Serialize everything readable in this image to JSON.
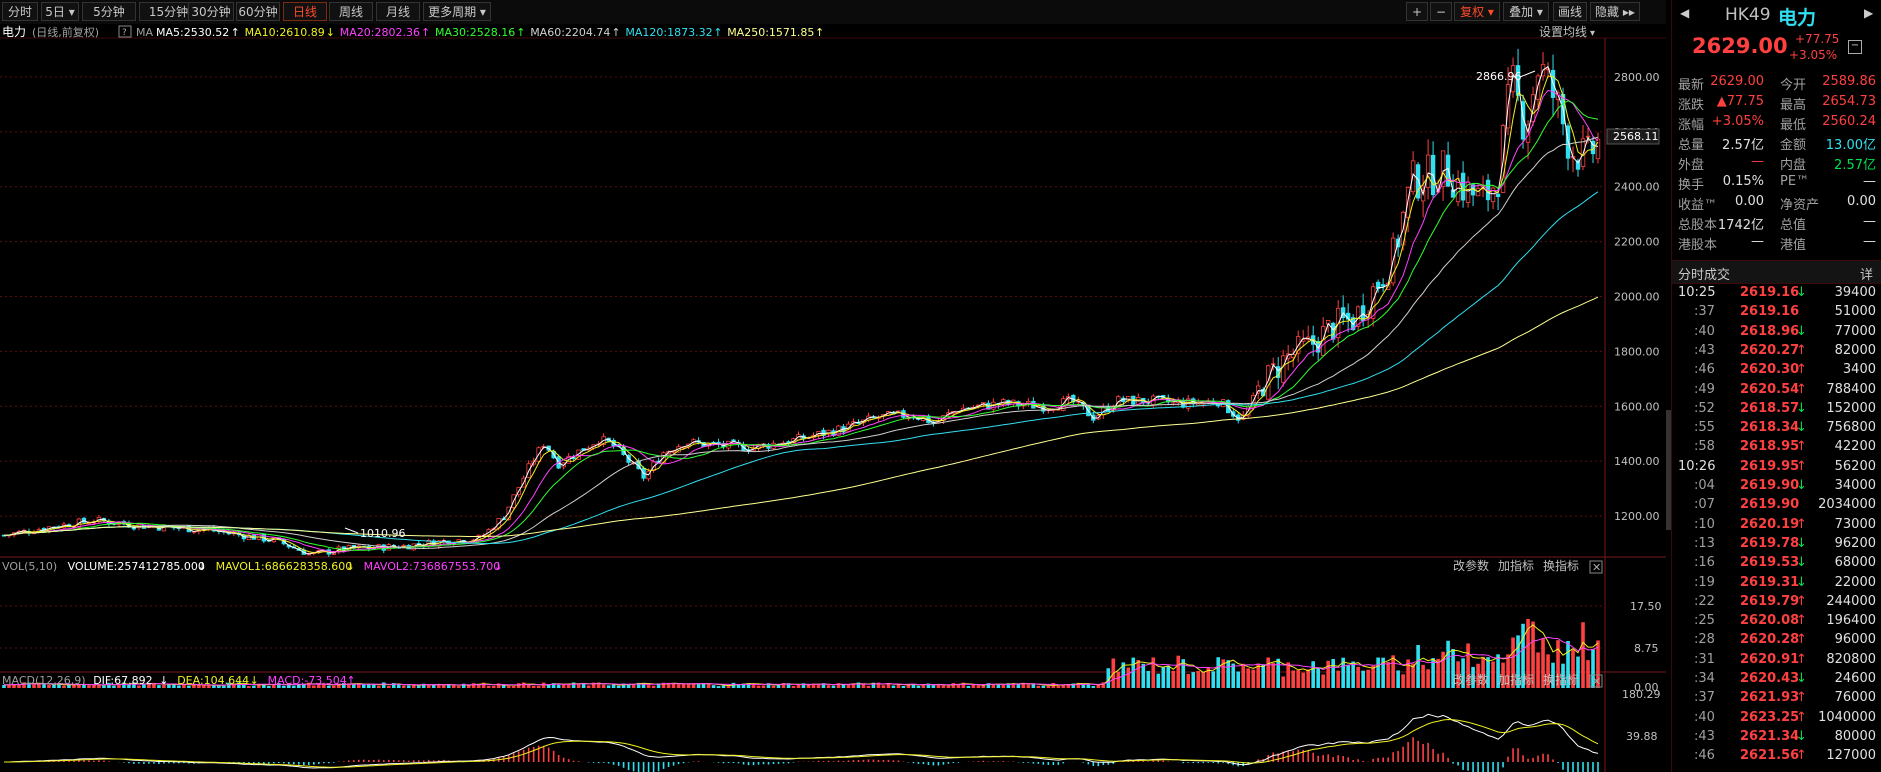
{
  "toolbar": {
    "periods": [
      "分时",
      "5日",
      "5分钟",
      "15分钟",
      "30分钟",
      "60分钟",
      "日线",
      "周线",
      "月线",
      "更多周期"
    ],
    "active_index": 6,
    "right_buttons": [
      "+",
      "−",
      "复权",
      "叠加",
      "画线",
      "隐藏"
    ]
  },
  "chart_header": {
    "name": "电力",
    "mode": "(日线,前复权)",
    "ma_prefix": "MA",
    "ma": [
      {
        "label": "MA5:2530.52",
        "color": "#ffffff",
        "arrow": "↑"
      },
      {
        "label": "MA10:2610.89",
        "color": "#f0f020",
        "arrow": "↓"
      },
      {
        "label": "MA20:2802.36",
        "color": "#ff40ff",
        "arrow": "↑"
      },
      {
        "label": "MA30:2528.16",
        "color": "#30ff30",
        "arrow": "↑"
      },
      {
        "label": "MA60:2204.74",
        "color": "#d0d0d0",
        "arrow": "↑"
      },
      {
        "label": "MA120:1873.32",
        "color": "#30e0f0",
        "arrow": "↑"
      },
      {
        "label": "MA250:1571.85",
        "color": "#ffff90",
        "arrow": "↑"
      }
    ],
    "settings": "设置均线"
  },
  "price_axis": {
    "ticks": [
      "2800.00",
      "2600.00",
      "2400.00",
      "2200.00",
      "2000.00",
      "1800.00",
      "1600.00",
      "1400.00",
      "1200.00"
    ],
    "current": "2568.11",
    "min": 1080,
    "max": 2920
  },
  "annotations": {
    "high": "2866.96",
    "low": "1010.96"
  },
  "volume_panel": {
    "labels": [
      {
        "text": "VOL(5,10)",
        "color": "#a0a0a0"
      },
      {
        "text": "VOLUME:257412785.000",
        "color": "#ffffff",
        "arrow": "↓"
      },
      {
        "text": "MAVOL1:686628358.600",
        "color": "#f0f020",
        "arrow": "↓"
      },
      {
        "text": "MAVOL2:736867553.700",
        "color": "#ff40ff",
        "arrow": "↓"
      }
    ],
    "ticks": [
      "17.50",
      "8.75",
      "0.00"
    ],
    "actions": [
      "改参数",
      "加指标",
      "换指标"
    ]
  },
  "macd_panel": {
    "labels": [
      {
        "text": "MACD(12,26,9)",
        "color": "#a0a0a0"
      },
      {
        "text": "DIF:67.892",
        "color": "#ffffff",
        "arrow": "↓"
      },
      {
        "text": "DEA:104.644",
        "color": "#f0f020",
        "arrow": "↓"
      },
      {
        "text": "MACD:-73.504",
        "color": "#ff40ff",
        "arrow": "↑"
      }
    ],
    "ticks": [
      "180.29",
      "39.88"
    ],
    "actions": [
      "改参数",
      "加指标",
      "换指标"
    ]
  },
  "quote": {
    "code": "HK49",
    "name": "电力",
    "price": "2629.00",
    "change": "+77.75",
    "change_pct": "+3.05%",
    "fields": [
      [
        "最新",
        "2629.00",
        "up",
        "今开",
        "2589.86",
        "up"
      ],
      [
        "涨跌",
        "▲77.75",
        "up",
        "最高",
        "2654.73",
        "up"
      ],
      [
        "涨幅",
        "+3.05%",
        "up",
        "最低",
        "2560.24",
        "up"
      ],
      [
        "总量",
        "2.57亿",
        "wt",
        "金额",
        "13.00亿",
        "cy"
      ],
      [
        "外盘",
        "—",
        "up",
        "内盘",
        "2.57亿",
        "dn"
      ],
      [
        "换手",
        "0.15%",
        "wt",
        "PE™",
        "—",
        "wt"
      ],
      [
        "收益™",
        "0.00",
        "wt",
        "净资产",
        "0.00",
        "wt"
      ],
      [
        "总股本",
        "1742亿",
        "wt",
        "总值",
        "—",
        "wt"
      ],
      [
        "港股本",
        "—",
        "wt",
        "港值",
        "—",
        "wt"
      ]
    ]
  },
  "trades": {
    "title": "分时成交",
    "detail": "详",
    "rows": [
      [
        "10:25",
        "2619.16",
        "dn",
        "39400"
      ],
      [
        ":37",
        "2619.16",
        "",
        "51000"
      ],
      [
        ":40",
        "2618.96",
        "dn",
        "77000"
      ],
      [
        ":43",
        "2620.27",
        "up",
        "82000"
      ],
      [
        ":46",
        "2620.30",
        "up",
        "3400"
      ],
      [
        ":49",
        "2620.54",
        "up",
        "788400"
      ],
      [
        ":52",
        "2618.57",
        "dn",
        "152000"
      ],
      [
        ":55",
        "2618.34",
        "dn",
        "756800"
      ],
      [
        ":58",
        "2618.95",
        "up",
        "42200"
      ],
      [
        "10:26",
        "2619.95",
        "up",
        "56200"
      ],
      [
        ":04",
        "2619.90",
        "dn",
        "34000"
      ],
      [
        ":07",
        "2619.90",
        "",
        "2034000"
      ],
      [
        ":10",
        "2620.19",
        "up",
        "73000"
      ],
      [
        ":13",
        "2619.78",
        "dn",
        "96200"
      ],
      [
        ":16",
        "2619.53",
        "dn",
        "68000"
      ],
      [
        ":19",
        "2619.31",
        "dn",
        "22000"
      ],
      [
        ":22",
        "2619.79",
        "up",
        "244000"
      ],
      [
        ":25",
        "2620.08",
        "up",
        "196400"
      ],
      [
        ":28",
        "2620.28",
        "up",
        "96000"
      ],
      [
        ":31",
        "2620.91",
        "up",
        "820800"
      ],
      [
        ":34",
        "2620.43",
        "dn",
        "24600"
      ],
      [
        ":37",
        "2621.93",
        "up",
        "76000"
      ],
      [
        ":40",
        "2623.25",
        "up",
        "1040000"
      ],
      [
        ":43",
        "2621.34",
        "dn",
        "80000"
      ],
      [
        ":46",
        "2621.56",
        "up",
        "127000"
      ]
    ]
  },
  "colors": {
    "up": "#ff4040",
    "down": "#30e0f0",
    "ma5": "#ffffff",
    "ma10": "#f0f020",
    "ma20": "#ff40ff",
    "ma30": "#30ff30",
    "ma60": "#d0d0d0",
    "ma120": "#30e0f0",
    "ma250": "#ffff90"
  }
}
